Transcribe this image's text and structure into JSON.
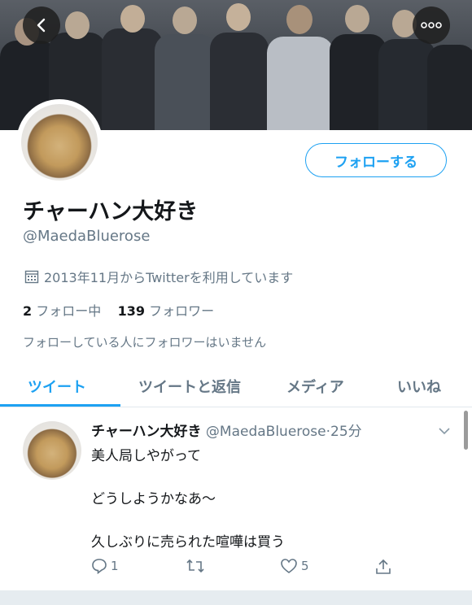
{
  "header": {
    "back_icon": "chevron-left-icon",
    "more_icon": "more-dots-icon"
  },
  "profile": {
    "display_name": "チャーハン大好き",
    "handle": "@MaedaBluerose",
    "follow_button": "フォローする",
    "joined": "2013年11月からTwitterを利用しています",
    "following_count": "2",
    "following_label": "フォロー中",
    "followers_count": "139",
    "followers_label": "フォロワー",
    "followers_note": "フォローしている人にフォロワーはいません"
  },
  "tabs": [
    {
      "label": "ツイート",
      "active": true
    },
    {
      "label": "ツイートと返信",
      "active": false
    },
    {
      "label": "メディア",
      "active": false
    },
    {
      "label": "いいね",
      "active": false
    }
  ],
  "tweet": {
    "author": "チャーハン大好き",
    "handle": "@MaedaBluerose",
    "time": "·25分",
    "lines": [
      "美人局しやがって",
      "どうしようかなあ～",
      "久しぶりに売られた喧嘩は買う"
    ],
    "reply_count": "1",
    "retweet_count": "",
    "like_count": "5"
  },
  "colors": {
    "accent": "#1da1f2",
    "text": "#14171a",
    "secondary": "#657786"
  }
}
